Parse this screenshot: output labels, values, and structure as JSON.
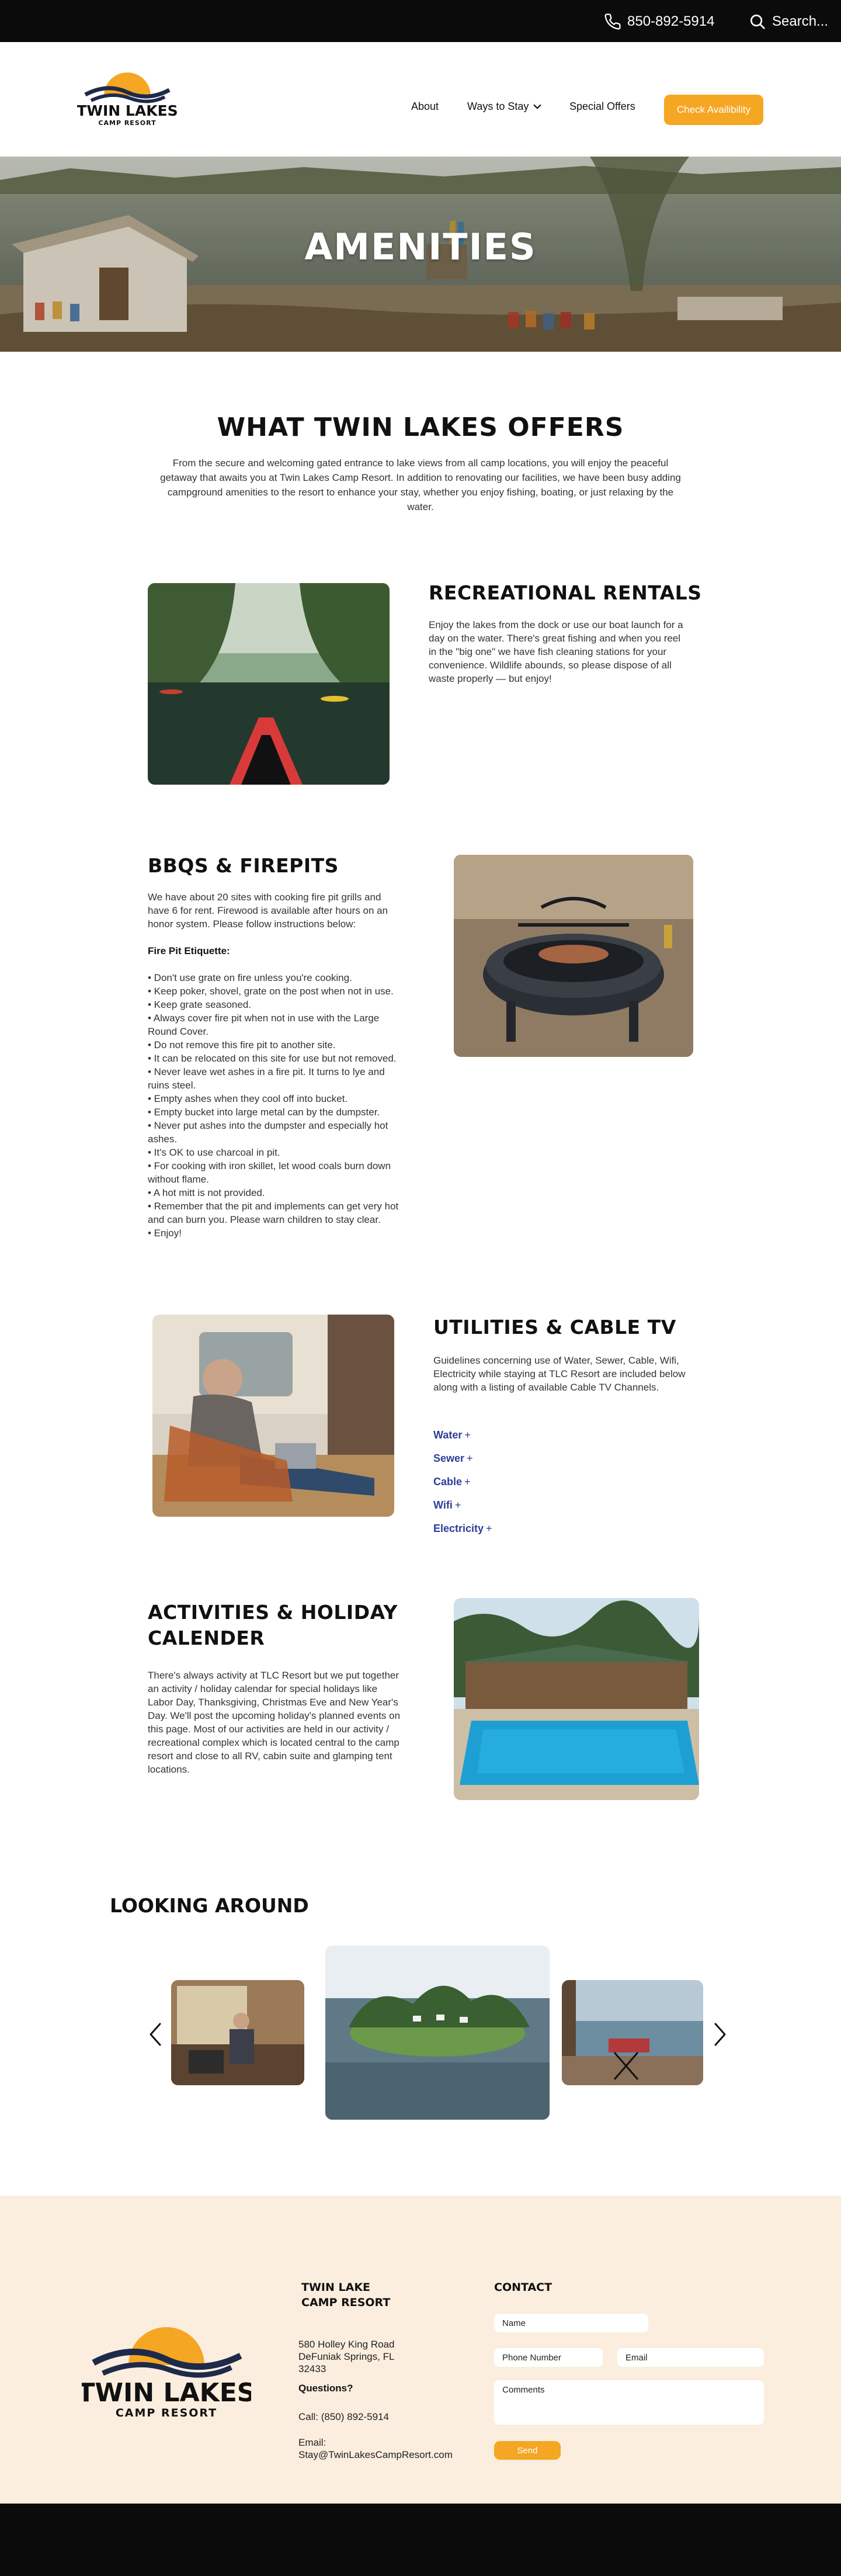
{
  "topbar": {
    "phone": "850-892-5914",
    "search_label": "Search..."
  },
  "brand": {
    "name_top": "TWIN LAKES",
    "name_bottom": "CAMP RESORT",
    "colors": {
      "accent": "#f5a623",
      "navy": "#1e2a4a",
      "link": "#2c3e99",
      "footer_bg": "#fbeedf"
    }
  },
  "nav": {
    "about": "About",
    "ways": "Ways to Stay",
    "offers": "Special Offers",
    "cta": "Check Availibility"
  },
  "hero": {
    "title": "AMENITIES"
  },
  "offers": {
    "title": "WHAT TWIN LAKES OFFERS",
    "body": "From the secure and welcoming gated entrance to lake views from all camp locations, you will enjoy the peaceful getaway that awaits you at Twin Lakes Camp Resort. In addition to renovating our facilities, we have been busy adding campground amenities to the resort to enhance your stay, whether you enjoy fishing, boating, or just relaxing by the water."
  },
  "rentals": {
    "title": "RECREATIONAL RENTALS",
    "body": "Enjoy the lakes from the dock or use our boat launch for a day on the water. There's great fishing and when you reel in the \"big one\" we have fish cleaning stations for your convenience. Wildlife abounds, so please dispose of all waste properly — but enjoy!"
  },
  "bbq": {
    "title": "BBQS & FIREPITS",
    "intro": "We have about 20 sites with cooking fire pit grills and have 6 for rent. Firewood is available after hours on an honor system. Please follow instructions below:",
    "etiquette_title": "Fire Pit Etiquette:",
    "rules": [
      "• Don't use grate on fire unless you're cooking.",
      "• Keep poker, shovel, grate on the post when not in use.",
      "• Keep grate seasoned.",
      "• Always cover fire pit when not in use with the Large Round Cover.",
      "• Do not remove this fire pit to another site.",
      "• It can be relocated on this site for use but not removed.",
      "• Never leave wet ashes in a fire pit. It turns to lye and ruins steel.",
      "• Empty ashes when they cool off into bucket.",
      "• Empty bucket into large metal can by the dumpster.",
      "• Never put ashes into the dumpster and especially hot ashes.",
      "• It's OK to use charcoal in pit.",
      "• For cooking with iron skillet, let wood coals burn down without flame.",
      "• A hot mitt is not provided.",
      "• Remember that the pit and implements can get very hot and can burn you. Please warn children to stay clear.",
      "• Enjoy!"
    ]
  },
  "utilities": {
    "title": "UTILITIES & CABLE TV",
    "body": "Guidelines concerning use of Water, Sewer, Cable, Wifi, Electricity while staying at TLC Resort are included below along with a listing of available Cable TV Channels.",
    "links": [
      "Water",
      "Sewer",
      "Cable",
      "Wifi",
      "Electricity"
    ],
    "plus": "+"
  },
  "activities": {
    "title_line1": "ACTIVITIES & HOLIDAY",
    "title_line2": "CALENDER",
    "body": "There's always activity at TLC Resort but we put together an activity / holiday calendar for special holidays like Labor Day, Thanksgiving, Christmas Eve and New Year's Day. We'll post the upcoming holiday's planned events on this page. Most of our activities are held in our activity / recreational complex which is located central to the camp resort and close to all RV, cabin suite and glamping tent locations."
  },
  "looking": {
    "title": "LOOKING AROUND"
  },
  "footer": {
    "name_line1": "TWIN LAKE",
    "name_line2": "CAMP RESORT",
    "address_line1": "580 Holley King Road",
    "address_line2": "DeFuniak Springs, FL",
    "address_line3": "32433",
    "questions": "Questions?",
    "call": "Call: (850) 892-5914",
    "email_label": "Email:",
    "email": "Stay@TwinLakesCampResort.com",
    "contact_title": "CONTACT",
    "form": {
      "name": "Name",
      "phone": "Phone Number",
      "email": "Email",
      "comments": "Comments",
      "send": "Send"
    }
  }
}
